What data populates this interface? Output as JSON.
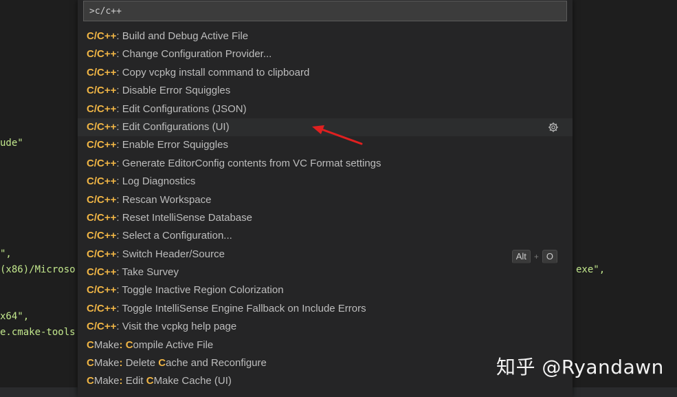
{
  "editor": {
    "fragments": [
      {
        "text": "ude\"",
        "cls": "yl"
      },
      {
        "text": "\",",
        "cls": "yl"
      },
      {
        "text": "(x86)/Microso",
        "cls": "yl"
      },
      {
        "text": "exe\",",
        "cls": "yl"
      },
      {
        "text": "x64\",",
        "cls": "yl"
      },
      {
        "text": "e.cmake-tools",
        "cls": "yl"
      }
    ]
  },
  "command_palette": {
    "input_value": ">c/c++",
    "items": [
      {
        "prefix": "C/C++",
        "label": ": Build and Debug Active File"
      },
      {
        "prefix": "C/C++",
        "label": ": Change Configuration Provider..."
      },
      {
        "prefix": "C/C++",
        "label": ": Copy vcpkg install command to clipboard"
      },
      {
        "prefix": "C/C++",
        "label": ": Disable Error Squiggles"
      },
      {
        "prefix": "C/C++",
        "label": ": Edit Configurations (JSON)"
      },
      {
        "prefix": "C/C++",
        "label": ": Edit Configurations (UI)",
        "selected": true,
        "icon": "gear-icon"
      },
      {
        "prefix": "C/C++",
        "label": ": Enable Error Squiggles"
      },
      {
        "prefix": "C/C++",
        "label": ": Generate EditorConfig contents from VC Format settings"
      },
      {
        "prefix": "C/C++",
        "label": ": Log Diagnostics"
      },
      {
        "prefix": "C/C++",
        "label": ": Rescan Workspace"
      },
      {
        "prefix": "C/C++",
        "label": ": Reset IntelliSense Database"
      },
      {
        "prefix": "C/C++",
        "label": ": Select a Configuration..."
      },
      {
        "prefix": "C/C++",
        "label": ": Switch Header/Source",
        "keybinding": [
          "Alt",
          "O"
        ]
      },
      {
        "prefix": "C/C++",
        "label": ": Take Survey"
      },
      {
        "prefix": "C/C++",
        "label": ": Toggle Inactive Region Colorization"
      },
      {
        "prefix": "C/C++",
        "label": ": Toggle IntelliSense Engine Fallback on Include Errors"
      },
      {
        "prefix": "C/C++",
        "label": ": Visit the vcpkg help page"
      },
      {
        "segments": [
          [
            "C",
            true
          ],
          [
            "Make",
            false
          ],
          [
            ":",
            true
          ],
          [
            " ",
            false
          ],
          [
            "C",
            true
          ],
          [
            "ompile Active File",
            false
          ]
        ]
      },
      {
        "segments": [
          [
            "C",
            true
          ],
          [
            "Make",
            false
          ],
          [
            ":",
            true
          ],
          [
            " Delete ",
            false
          ],
          [
            "C",
            true
          ],
          [
            "ache and Reconfigure",
            false
          ]
        ]
      },
      {
        "segments": [
          [
            "C",
            true
          ],
          [
            "Make",
            false
          ],
          [
            ":",
            true
          ],
          [
            " Edit ",
            false
          ],
          [
            "C",
            true
          ],
          [
            "Make Cache (UI)",
            false
          ]
        ]
      }
    ],
    "keybinding_separator": "+",
    "annotation_color": "#e02020"
  },
  "watermark": "知乎 @Ryandawn"
}
